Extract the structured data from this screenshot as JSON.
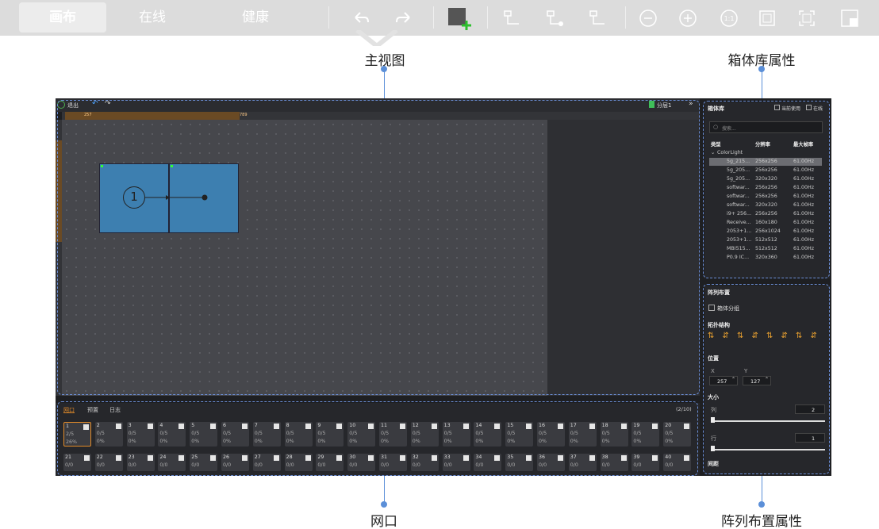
{
  "toolbar": {
    "tabs": [
      "画布",
      "在线",
      "健康"
    ],
    "active_tab": "画布",
    "icons": [
      "undo-icon",
      "redo-icon",
      "add-cabinet-icon",
      "route-icon",
      "route-dot-icon",
      "zoom-out-icon",
      "zoom-in-icon",
      "zoom-1to1-icon",
      "fit-icon",
      "fullscreen-icon",
      "layout-icon"
    ]
  },
  "annotations": {
    "main_view": "主视图",
    "cabinet_lib_props": "箱体库属性",
    "port": "网口",
    "array_layout_props": "阵列布置属性"
  },
  "main_view": {
    "exit_label": "退出",
    "layer_label": "分层1",
    "ruler_start": "257",
    "ruler_end": "789",
    "cabinet_index": "1"
  },
  "cabinet_library": {
    "title": "箱体库",
    "current_use": "当前使用",
    "online": "在线",
    "search_placeholder": "搜索...",
    "columns": [
      "类型",
      "分辨率",
      "最大帧率"
    ],
    "group": "ColorLight",
    "rows": [
      [
        "5g_215...",
        "256x256",
        "61.00Hz"
      ],
      [
        "5g_205...",
        "256x256",
        "61.00Hz"
      ],
      [
        "5g_205...",
        "320x320",
        "61.00Hz"
      ],
      [
        "softwar...",
        "256x256",
        "61.00Hz"
      ],
      [
        "softwar...",
        "256x256",
        "61.00Hz"
      ],
      [
        "softwar...",
        "320x320",
        "61.00Hz"
      ],
      [
        "i9+ 256...",
        "256x256",
        "61.00Hz"
      ],
      [
        "Receive...",
        "160x180",
        "61.00Hz"
      ],
      [
        "2053+1...",
        "256x1024",
        "61.00Hz"
      ],
      [
        "2053+1...",
        "512x512",
        "61.00Hz"
      ],
      [
        "MBI515...",
        "512x512",
        "61.00Hz"
      ],
      [
        "P0.9 IC...",
        "320x360",
        "61.00Hz"
      ]
    ]
  },
  "array_layout": {
    "title": "阵列布置",
    "cabinet_group": "箱体分组",
    "topology": "拓扑结构",
    "position": "位置",
    "x_label": "X",
    "y_label": "Y",
    "x_value": "257",
    "y_value": "127",
    "size": "大小",
    "cols_label": "列",
    "cols_value": "2",
    "rows_label": "行",
    "rows_value": "1",
    "spacing": "间距"
  },
  "ports": {
    "tabs": [
      "网口",
      "预置",
      "日志"
    ],
    "active_tab": "网口",
    "page": "(2/10)",
    "row1": [
      {
        "n": "1",
        "frac": "2/5",
        "pct": "26%"
      },
      {
        "n": "2",
        "frac": "0/5",
        "pct": "0%"
      },
      {
        "n": "3",
        "frac": "0/5",
        "pct": "0%"
      },
      {
        "n": "4",
        "frac": "0/5",
        "pct": "0%"
      },
      {
        "n": "5",
        "frac": "0/5",
        "pct": "0%"
      },
      {
        "n": "6",
        "frac": "0/5",
        "pct": "0%"
      },
      {
        "n": "7",
        "frac": "0/5",
        "pct": "0%"
      },
      {
        "n": "8",
        "frac": "0/5",
        "pct": "0%"
      },
      {
        "n": "9",
        "frac": "0/5",
        "pct": "0%"
      },
      {
        "n": "10",
        "frac": "0/5",
        "pct": "0%"
      },
      {
        "n": "11",
        "frac": "0/5",
        "pct": "0%"
      },
      {
        "n": "12",
        "frac": "0/5",
        "pct": "0%"
      },
      {
        "n": "13",
        "frac": "0/5",
        "pct": "0%"
      },
      {
        "n": "14",
        "frac": "0/5",
        "pct": "0%"
      },
      {
        "n": "15",
        "frac": "0/5",
        "pct": "0%"
      },
      {
        "n": "16",
        "frac": "0/5",
        "pct": "0%"
      },
      {
        "n": "17",
        "frac": "0/5",
        "pct": "0%"
      },
      {
        "n": "18",
        "frac": "0/5",
        "pct": "0%"
      },
      {
        "n": "19",
        "frac": "0/5",
        "pct": "0%"
      },
      {
        "n": "20",
        "frac": "0/5",
        "pct": "0%"
      }
    ],
    "row2": [
      {
        "n": "21",
        "frac": "0/0"
      },
      {
        "n": "22",
        "frac": "0/0"
      },
      {
        "n": "23",
        "frac": "0/0"
      },
      {
        "n": "24",
        "frac": "0/0"
      },
      {
        "n": "25",
        "frac": "0/0"
      },
      {
        "n": "26",
        "frac": "0/0"
      },
      {
        "n": "27",
        "frac": "0/0"
      },
      {
        "n": "28",
        "frac": "0/0"
      },
      {
        "n": "29",
        "frac": "0/0"
      },
      {
        "n": "30",
        "frac": "0/0"
      },
      {
        "n": "31",
        "frac": "0/0"
      },
      {
        "n": "32",
        "frac": "0/0"
      },
      {
        "n": "33",
        "frac": "0/0"
      },
      {
        "n": "34",
        "frac": "0/0"
      },
      {
        "n": "35",
        "frac": "0/0"
      },
      {
        "n": "36",
        "frac": "0/0"
      },
      {
        "n": "37",
        "frac": "0/0"
      },
      {
        "n": "38",
        "frac": "0/0"
      },
      {
        "n": "39",
        "frac": "0/0"
      },
      {
        "n": "40",
        "frac": "0/0"
      }
    ]
  },
  "colors": {
    "accent": "#5b8fd8",
    "cabinet": "#3d7fb0",
    "port_selected": "#e08a2a"
  }
}
